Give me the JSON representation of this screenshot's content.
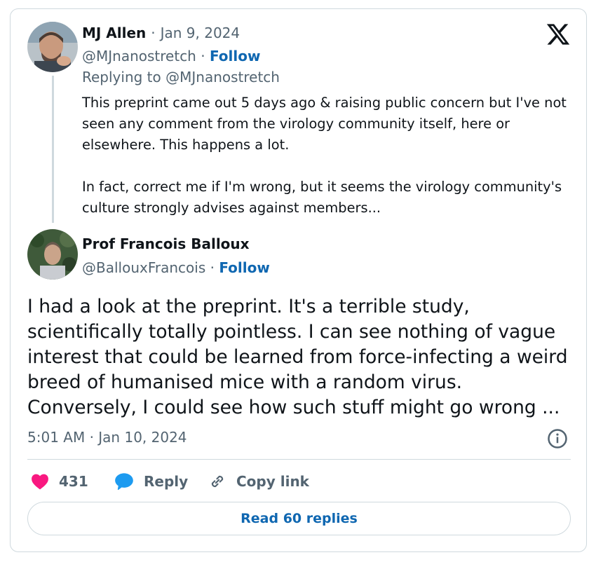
{
  "reply_tweet": {
    "author_name": "MJ Allen",
    "separator": "·",
    "date": "Jan 9, 2024",
    "handle": "@MJnanostretch",
    "follow_label": "Follow",
    "replying_to": "Replying to @MJnanostretch",
    "text_p1": "This preprint came out 5 days ago & raising public concern but I've not seen any comment from the virology community itself, here or elsewhere. This happens a lot.",
    "text_p2": "In fact, correct me if I'm wrong, but it seems the virology community's culture strongly advises against members..."
  },
  "main_tweet": {
    "author_name": "Prof Francois Balloux",
    "handle": "@BallouxFrancois",
    "separator": "·",
    "follow_label": "Follow",
    "text": "I had a look at the preprint. It's a terrible study, scientifically totally pointless. I can see nothing of vague interest that could be learned from force-infecting a weird breed of humanised mice with a random virus. Conversely, I could see how such stuff might go wrong ...",
    "timestamp": "5:01 AM · Jan 10, 2024"
  },
  "actions": {
    "like_count": "431",
    "reply_label": "Reply",
    "copy_link_label": "Copy link"
  },
  "read_replies_label": "Read 60 replies",
  "icons": {
    "platform_logo": "x-logo-icon",
    "like": "heart-icon",
    "reply": "speech-bubble-icon",
    "copy_link": "link-icon",
    "info": "info-icon"
  },
  "colors": {
    "like": "#f91880",
    "reply": "#1d9bf0",
    "link_blue": "#0f67b1",
    "muted": "#536471",
    "border": "#cfd9de"
  }
}
